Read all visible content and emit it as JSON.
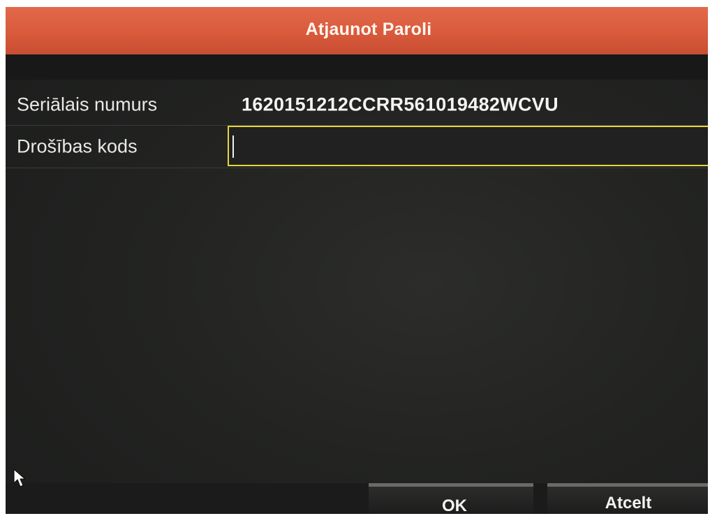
{
  "dialog": {
    "title": "Atjaunot Paroli"
  },
  "form": {
    "serial": {
      "label": "Seriālais numurs",
      "value": "1620151212CCRR561019482WCVU"
    },
    "security_code": {
      "label": "Drošības kods",
      "value": ""
    }
  },
  "buttons": {
    "ok_label": "OK",
    "cancel_label": "Atcelt"
  },
  "colors": {
    "title_bar": "#d95a3c",
    "input_focus_border": "#e8d63a",
    "background": "#232422"
  },
  "icons": {
    "pointer": "mouse-pointer-icon"
  }
}
